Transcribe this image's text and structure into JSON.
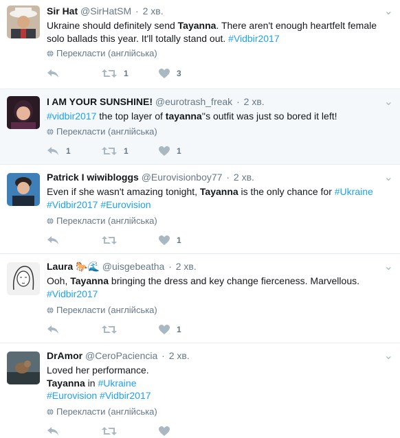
{
  "translate_label": "Перекласти (англійська)",
  "tweets": [
    {
      "name": "Sir Hat",
      "handle": "@SirHatSM",
      "time": "2 хв.",
      "lines": [
        [
          {
            "t": "Ukraine should definitely send "
          },
          {
            "t": "Tayanna",
            "b": true
          },
          {
            "t": ". There aren't enough heartfelt female"
          }
        ],
        [
          {
            "t": "solo ballads this year. It'll totally stand out. "
          },
          {
            "t": "#Vidbir2017",
            "tag": true
          }
        ]
      ],
      "reply_count": "",
      "retweet_count": "1",
      "like_count": "3"
    },
    {
      "name": "I AM YOUR SUNSHINE!",
      "handle": "@eurotrash_freak",
      "time": "2 хв.",
      "lines": [
        [
          {
            "t": "#vidbir2017",
            "tag": true
          },
          {
            "t": " the top layer of "
          },
          {
            "t": "tayanna",
            "b": true
          },
          {
            "t": "''s outfit was just so bored it left!"
          }
        ]
      ],
      "reply_count": "1",
      "retweet_count": "1",
      "like_count": "1"
    },
    {
      "name": "Patrick I wiwibloggs",
      "handle": "@Eurovisionboy77",
      "time": "2 хв.",
      "lines": [
        [
          {
            "t": "Even if she wasn't amazing tonight, "
          },
          {
            "t": "Tayanna",
            "b": true
          },
          {
            "t": " is the only chance for "
          },
          {
            "t": "#Ukraine",
            "tag": true
          }
        ],
        [
          {
            "t": "#Vidbir2017",
            "tag": true
          },
          {
            "t": " "
          },
          {
            "t": "#Eurovision",
            "tag": true
          }
        ]
      ],
      "reply_count": "",
      "retweet_count": "",
      "like_count": "1"
    },
    {
      "name": "Laura 🐎🌊",
      "handle": "@uisgebeatha",
      "time": "2 хв.",
      "lines": [
        [
          {
            "t": "Ooh, "
          },
          {
            "t": "Tayanna",
            "b": true
          },
          {
            "t": " bringing the dress and key change fierceness. Marvellous."
          }
        ],
        [
          {
            "t": "#Vidbir2017",
            "tag": true
          }
        ]
      ],
      "reply_count": "",
      "retweet_count": "",
      "like_count": "1"
    },
    {
      "name": "DrAmor",
      "handle": "@CeroPaciencia",
      "time": "2 хв.",
      "lines": [
        [
          {
            "t": "Loved her performance."
          }
        ],
        [
          {
            "t": "Tayanna",
            "b": true
          },
          {
            "t": " in "
          },
          {
            "t": "#Ukraine",
            "tag": true
          }
        ],
        [
          {
            "t": "#Eurovision",
            "tag": true
          },
          {
            "t": " "
          },
          {
            "t": "#Vidbir2017",
            "tag": true
          }
        ]
      ],
      "reply_count": "",
      "retweet_count": "",
      "like_count": ""
    }
  ]
}
